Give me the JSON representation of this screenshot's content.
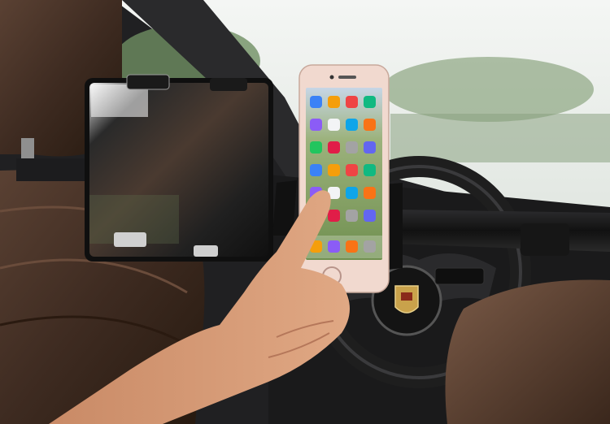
{
  "scene": {
    "subject": "car-headrest-tablet-and-phone-mount",
    "icons": [
      "tablet",
      "smartphone",
      "steering-wheel",
      "headrest",
      "hand",
      "car-emblem"
    ],
    "colors": {
      "interior_dark": "#1c1c1e",
      "window_light": "#eef1ee",
      "foliage": "#6f8f63",
      "leather": "#4a3428",
      "leather_highlight": "#7a5a47",
      "skin": "#d89a74",
      "phone_frame": "#f1d9cf",
      "phone_screen": "#8fa86a",
      "emblem_gold": "#c9a24b"
    },
    "phone": {
      "app_icon_rows": 6,
      "app_icon_columns": 4,
      "dock_icons": 4,
      "app_icon_colors": [
        "#3b82f6",
        "#f59e0b",
        "#ef4444",
        "#10b981",
        "#8b5cf6",
        "#f3f4f6",
        "#0ea5e9",
        "#f97316",
        "#22c55e",
        "#e11d48",
        "#a3a3a3",
        "#6366f1"
      ]
    }
  }
}
